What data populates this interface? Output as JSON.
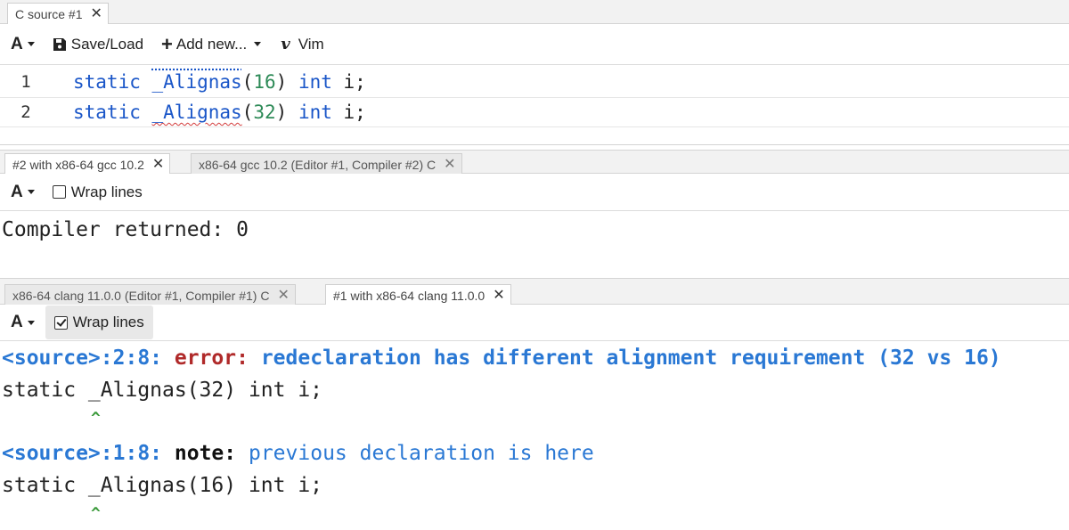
{
  "editor_pane": {
    "tab_label": "C source #1",
    "toolbar": {
      "font_btn": "A",
      "save_label": "Save/Load",
      "add_label": "Add new...",
      "vim_label": "Vim"
    },
    "lines": [
      {
        "number": "1",
        "kw1": "static",
        "ident": "_Alignas",
        "open": "(",
        "num": "16",
        "close": ")",
        "kw2": "int",
        "rest": "i;"
      },
      {
        "number": "2",
        "kw1": "static",
        "ident": "_Alignas",
        "open": "(",
        "num": "32",
        "close": ")",
        "kw2": "int",
        "rest": "i;"
      }
    ]
  },
  "gcc_pane": {
    "tabs": [
      {
        "label": "#2 with x86-64 gcc 10.2"
      },
      {
        "label": "x86-64 gcc 10.2 (Editor #1, Compiler #2) C"
      }
    ],
    "toolbar": {
      "font_btn": "A",
      "wrap_label": "Wrap lines",
      "wrap_checked": false
    },
    "output": [
      "Compiler returned: 0"
    ]
  },
  "clang_pane": {
    "tabs": [
      {
        "label": "x86-64 clang 11.0.0 (Editor #1, Compiler #1) C"
      },
      {
        "label": "#1 with x86-64 clang 11.0.0"
      }
    ],
    "toolbar": {
      "font_btn": "A",
      "wrap_label": "Wrap lines",
      "wrap_checked": true
    },
    "diagnostics": [
      {
        "loc": "<source>:2:8:",
        "kind": "error:",
        "message": "redeclaration has different alignment requirement (32 vs 16)",
        "source": "static _Alignas(32) int i;",
        "caret": "^"
      },
      {
        "loc": "<source>:1:8:",
        "kind": "note:",
        "message": "previous declaration is here",
        "source": "static _Alignas(16) int i;",
        "caret": "^"
      }
    ]
  },
  "icons": {
    "close": "close-icon",
    "save": "floppy-disk-icon",
    "add": "plus-icon",
    "vim": "vim-logo-icon"
  },
  "colors": {
    "keyword": "#1a56c8",
    "number": "#2d8a57",
    "error": "#b02a2a",
    "caret": "#3a9a3a"
  }
}
